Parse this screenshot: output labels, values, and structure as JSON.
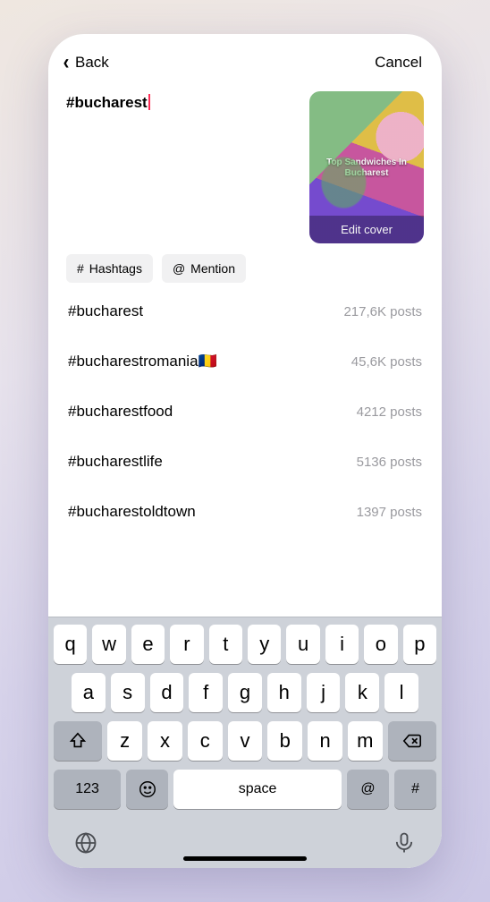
{
  "nav": {
    "back_label": "Back",
    "cancel_label": "Cancel"
  },
  "compose": {
    "caption_text": "#bucharest",
    "cover_title": "Top Sandwiches In Bucharest",
    "edit_cover_label": "Edit cover"
  },
  "chips": {
    "hashtags_label": "Hashtags",
    "mention_label": "Mention",
    "hash_symbol": "#",
    "at_symbol": "@"
  },
  "suggestions": [
    {
      "tag": "#bucharest",
      "count": "217,6K posts"
    },
    {
      "tag": "#bucharestromania🇷🇴",
      "count": "45,6K posts"
    },
    {
      "tag": "#bucharestfood",
      "count": "4212 posts"
    },
    {
      "tag": "#bucharestlife",
      "count": "5136 posts"
    },
    {
      "tag": "#bucharestoldtown",
      "count": "1397 posts"
    }
  ],
  "keyboard": {
    "row1": [
      "q",
      "w",
      "e",
      "r",
      "t",
      "y",
      "u",
      "i",
      "o",
      "p"
    ],
    "row2": [
      "a",
      "s",
      "d",
      "f",
      "g",
      "h",
      "j",
      "k",
      "l"
    ],
    "row3": [
      "z",
      "x",
      "c",
      "v",
      "b",
      "n",
      "m"
    ],
    "numbers_label": "123",
    "space_label": "space",
    "at_label": "@",
    "hash_label": "#"
  }
}
